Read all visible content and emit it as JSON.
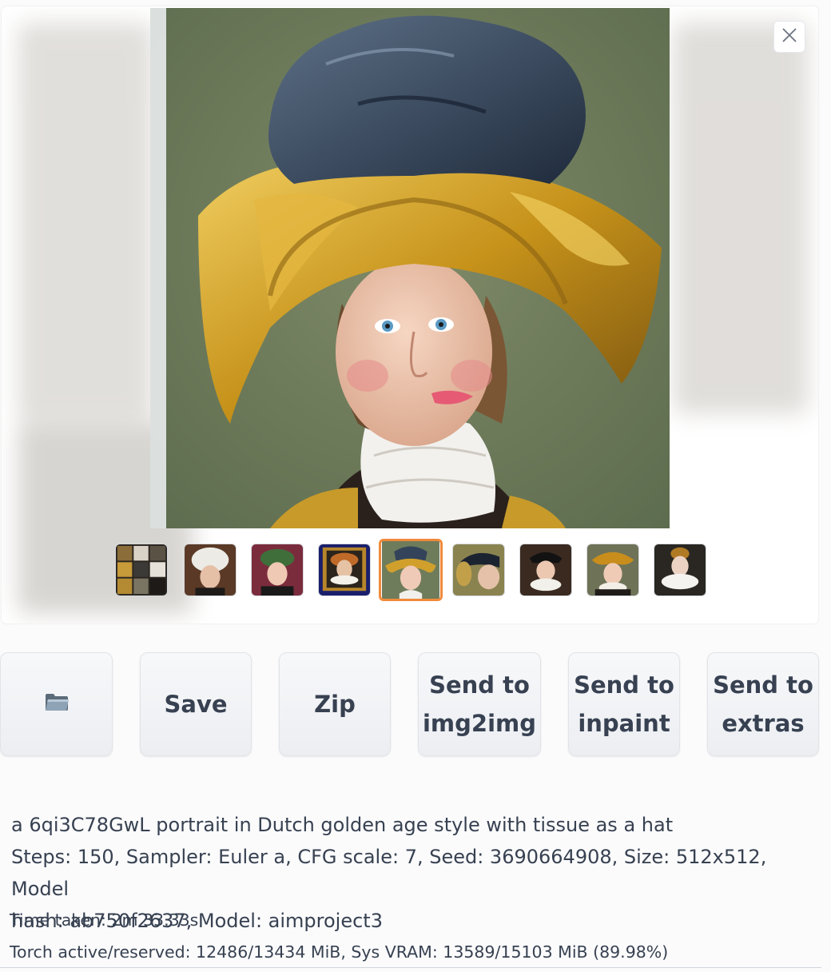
{
  "gallery": {
    "close_icon": "close-icon",
    "thumbnails": [
      {
        "name": "grid-thumbnail",
        "selected": false
      },
      {
        "name": "portrait-thumbnail-white-turban",
        "selected": false
      },
      {
        "name": "portrait-thumbnail-green-hat",
        "selected": false
      },
      {
        "name": "portrait-thumbnail-framed",
        "selected": false
      },
      {
        "name": "portrait-thumbnail-gold-hat",
        "selected": true
      },
      {
        "name": "portrait-thumbnail-dark-hat",
        "selected": false
      },
      {
        "name": "portrait-thumbnail-ruff-collar",
        "selected": false
      },
      {
        "name": "portrait-thumbnail-gold-bow",
        "selected": false
      },
      {
        "name": "portrait-thumbnail-white-ruff",
        "selected": false
      }
    ]
  },
  "buttons": {
    "folder_icon": "folder-icon",
    "save": "Save",
    "zip": "Zip",
    "send_img2img": "Send to img2img",
    "send_inpaint": "Send to inpaint",
    "send_extras": "Send to extras"
  },
  "info": {
    "prompt": "a 6qi3C78GwL portrait in Dutch golden age style with tissue as a hat",
    "params_line1": "Steps: 150, Sampler: Euler a, CFG scale: 7, Seed: 3690664908, Size: 512x512, Model",
    "params_line2": "hash: ab750f2637, Model: aimproject3",
    "time_taken": "Time taken: 2m 33.33s",
    "vram": "Torch active/reserved: 12486/13434 MiB, Sys VRAM: 13589/15103 MiB (89.98%)"
  },
  "colors": {
    "accent": "#f08a3c",
    "button_bg": "#eceef2",
    "text": "#374151"
  }
}
